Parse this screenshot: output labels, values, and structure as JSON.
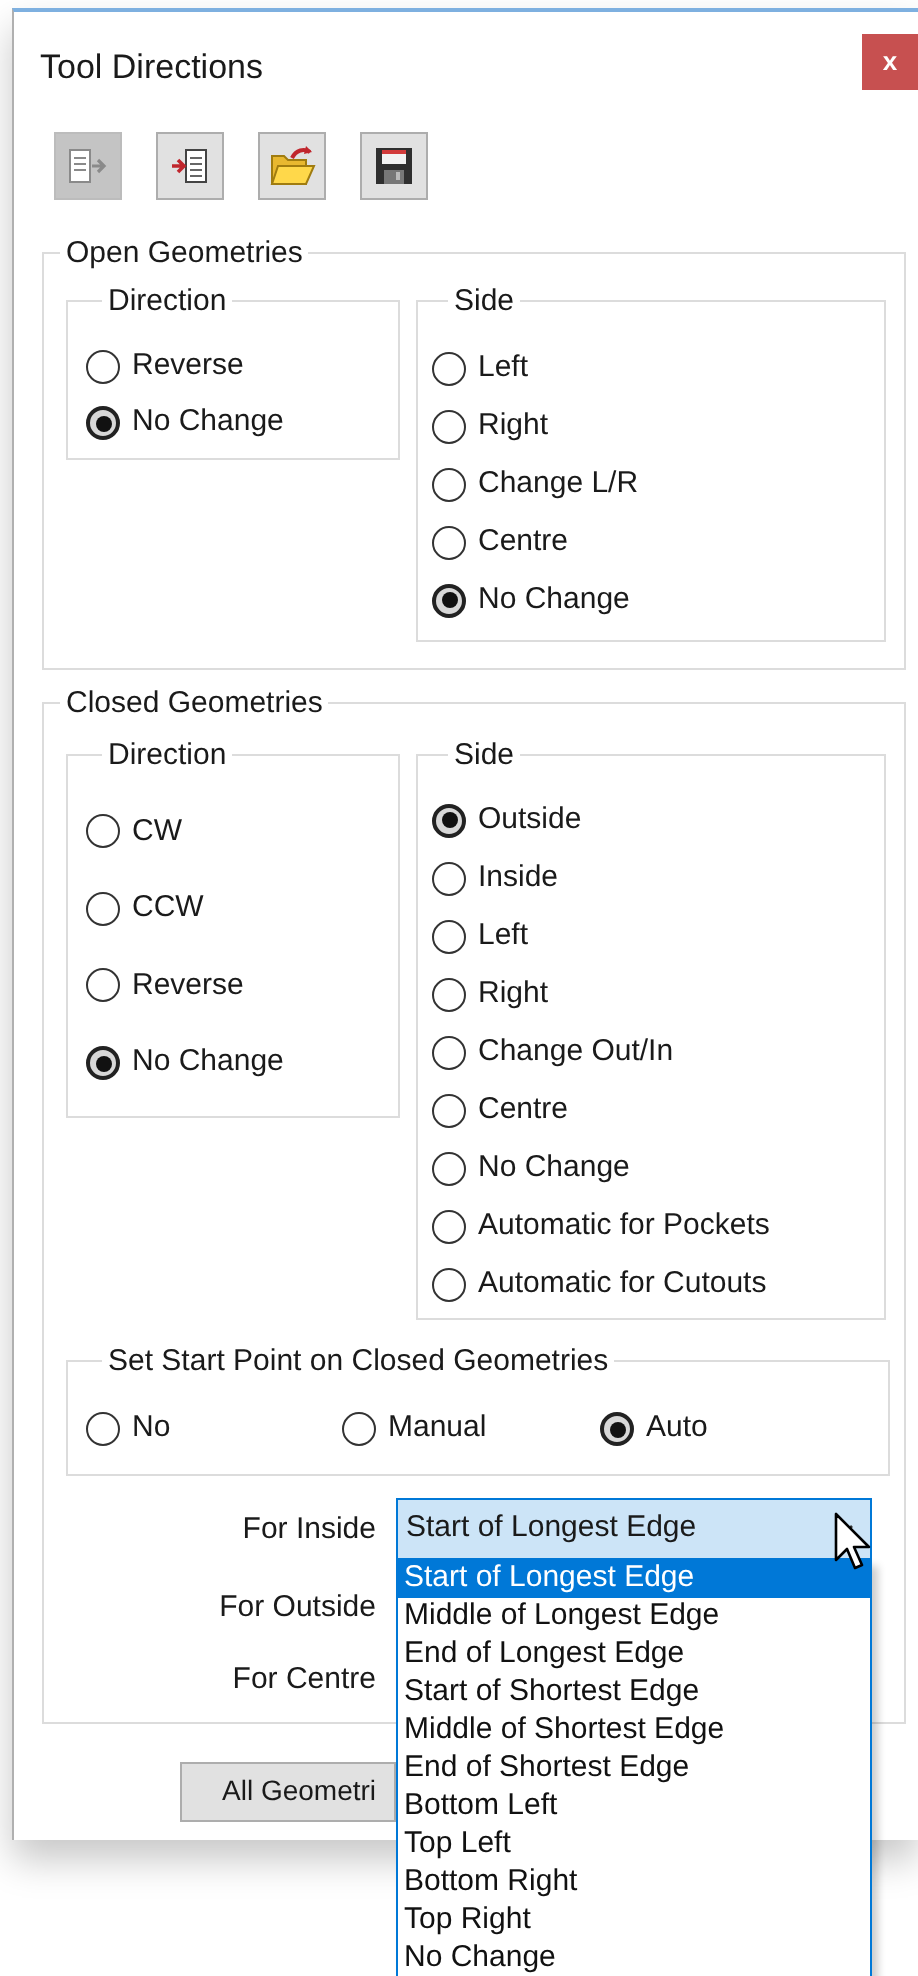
{
  "window": {
    "title": "Tool Directions",
    "close_label": "x"
  },
  "toolbar": [
    {
      "kind": "export",
      "disabled": true
    },
    {
      "kind": "import",
      "disabled": false
    },
    {
      "kind": "open",
      "disabled": false
    },
    {
      "kind": "save",
      "disabled": false
    }
  ],
  "open_geometries": {
    "title": "Open Geometries",
    "direction": {
      "title": "Direction",
      "options": [
        {
          "label": "Reverse",
          "selected": false
        },
        {
          "label": "No Change",
          "selected": true
        }
      ]
    },
    "side": {
      "title": "Side",
      "options": [
        {
          "label": "Left",
          "selected": false
        },
        {
          "label": "Right",
          "selected": false
        },
        {
          "label": "Change L/R",
          "selected": false
        },
        {
          "label": "Centre",
          "selected": false
        },
        {
          "label": "No Change",
          "selected": true
        }
      ]
    }
  },
  "closed_geometries": {
    "title": "Closed Geometries",
    "direction": {
      "title": "Direction",
      "options": [
        {
          "label": "CW",
          "selected": false
        },
        {
          "label": "CCW",
          "selected": false
        },
        {
          "label": "Reverse",
          "selected": false
        },
        {
          "label": "No Change",
          "selected": true
        }
      ]
    },
    "side": {
      "title": "Side",
      "options": [
        {
          "label": "Outside",
          "selected": true
        },
        {
          "label": "Inside",
          "selected": false
        },
        {
          "label": "Left",
          "selected": false
        },
        {
          "label": "Right",
          "selected": false
        },
        {
          "label": "Change Out/In",
          "selected": false
        },
        {
          "label": "Centre",
          "selected": false
        },
        {
          "label": "No Change",
          "selected": false
        },
        {
          "label": "Automatic for Pockets",
          "selected": false
        },
        {
          "label": "Automatic for Cutouts",
          "selected": false
        }
      ]
    },
    "start_point": {
      "title": "Set Start Point on Closed Geometries",
      "options": [
        {
          "label": "No",
          "selected": false
        },
        {
          "label": "Manual",
          "selected": false
        },
        {
          "label": "Auto",
          "selected": true
        }
      ]
    },
    "selectors": [
      {
        "label": "For Inside",
        "value": "Start of Longest Edge"
      },
      {
        "label": "For Outside"
      },
      {
        "label": "For Centre"
      }
    ]
  },
  "dropdown": {
    "options": [
      {
        "label": "Start of Longest Edge",
        "selected": true
      },
      {
        "label": "Middle of Longest Edge",
        "selected": false
      },
      {
        "label": "End of Longest Edge",
        "selected": false
      },
      {
        "label": "Start of Shortest Edge",
        "selected": false
      },
      {
        "label": "Middle of Shortest Edge",
        "selected": false
      },
      {
        "label": "End of Shortest Edge",
        "selected": false
      },
      {
        "label": "Bottom Left",
        "selected": false
      },
      {
        "label": "Top Left",
        "selected": false
      },
      {
        "label": "Bottom Right",
        "selected": false
      },
      {
        "label": "Top Right",
        "selected": false
      },
      {
        "label": "No Change",
        "selected": false
      }
    ]
  },
  "button": {
    "label": "All Geometri"
  }
}
